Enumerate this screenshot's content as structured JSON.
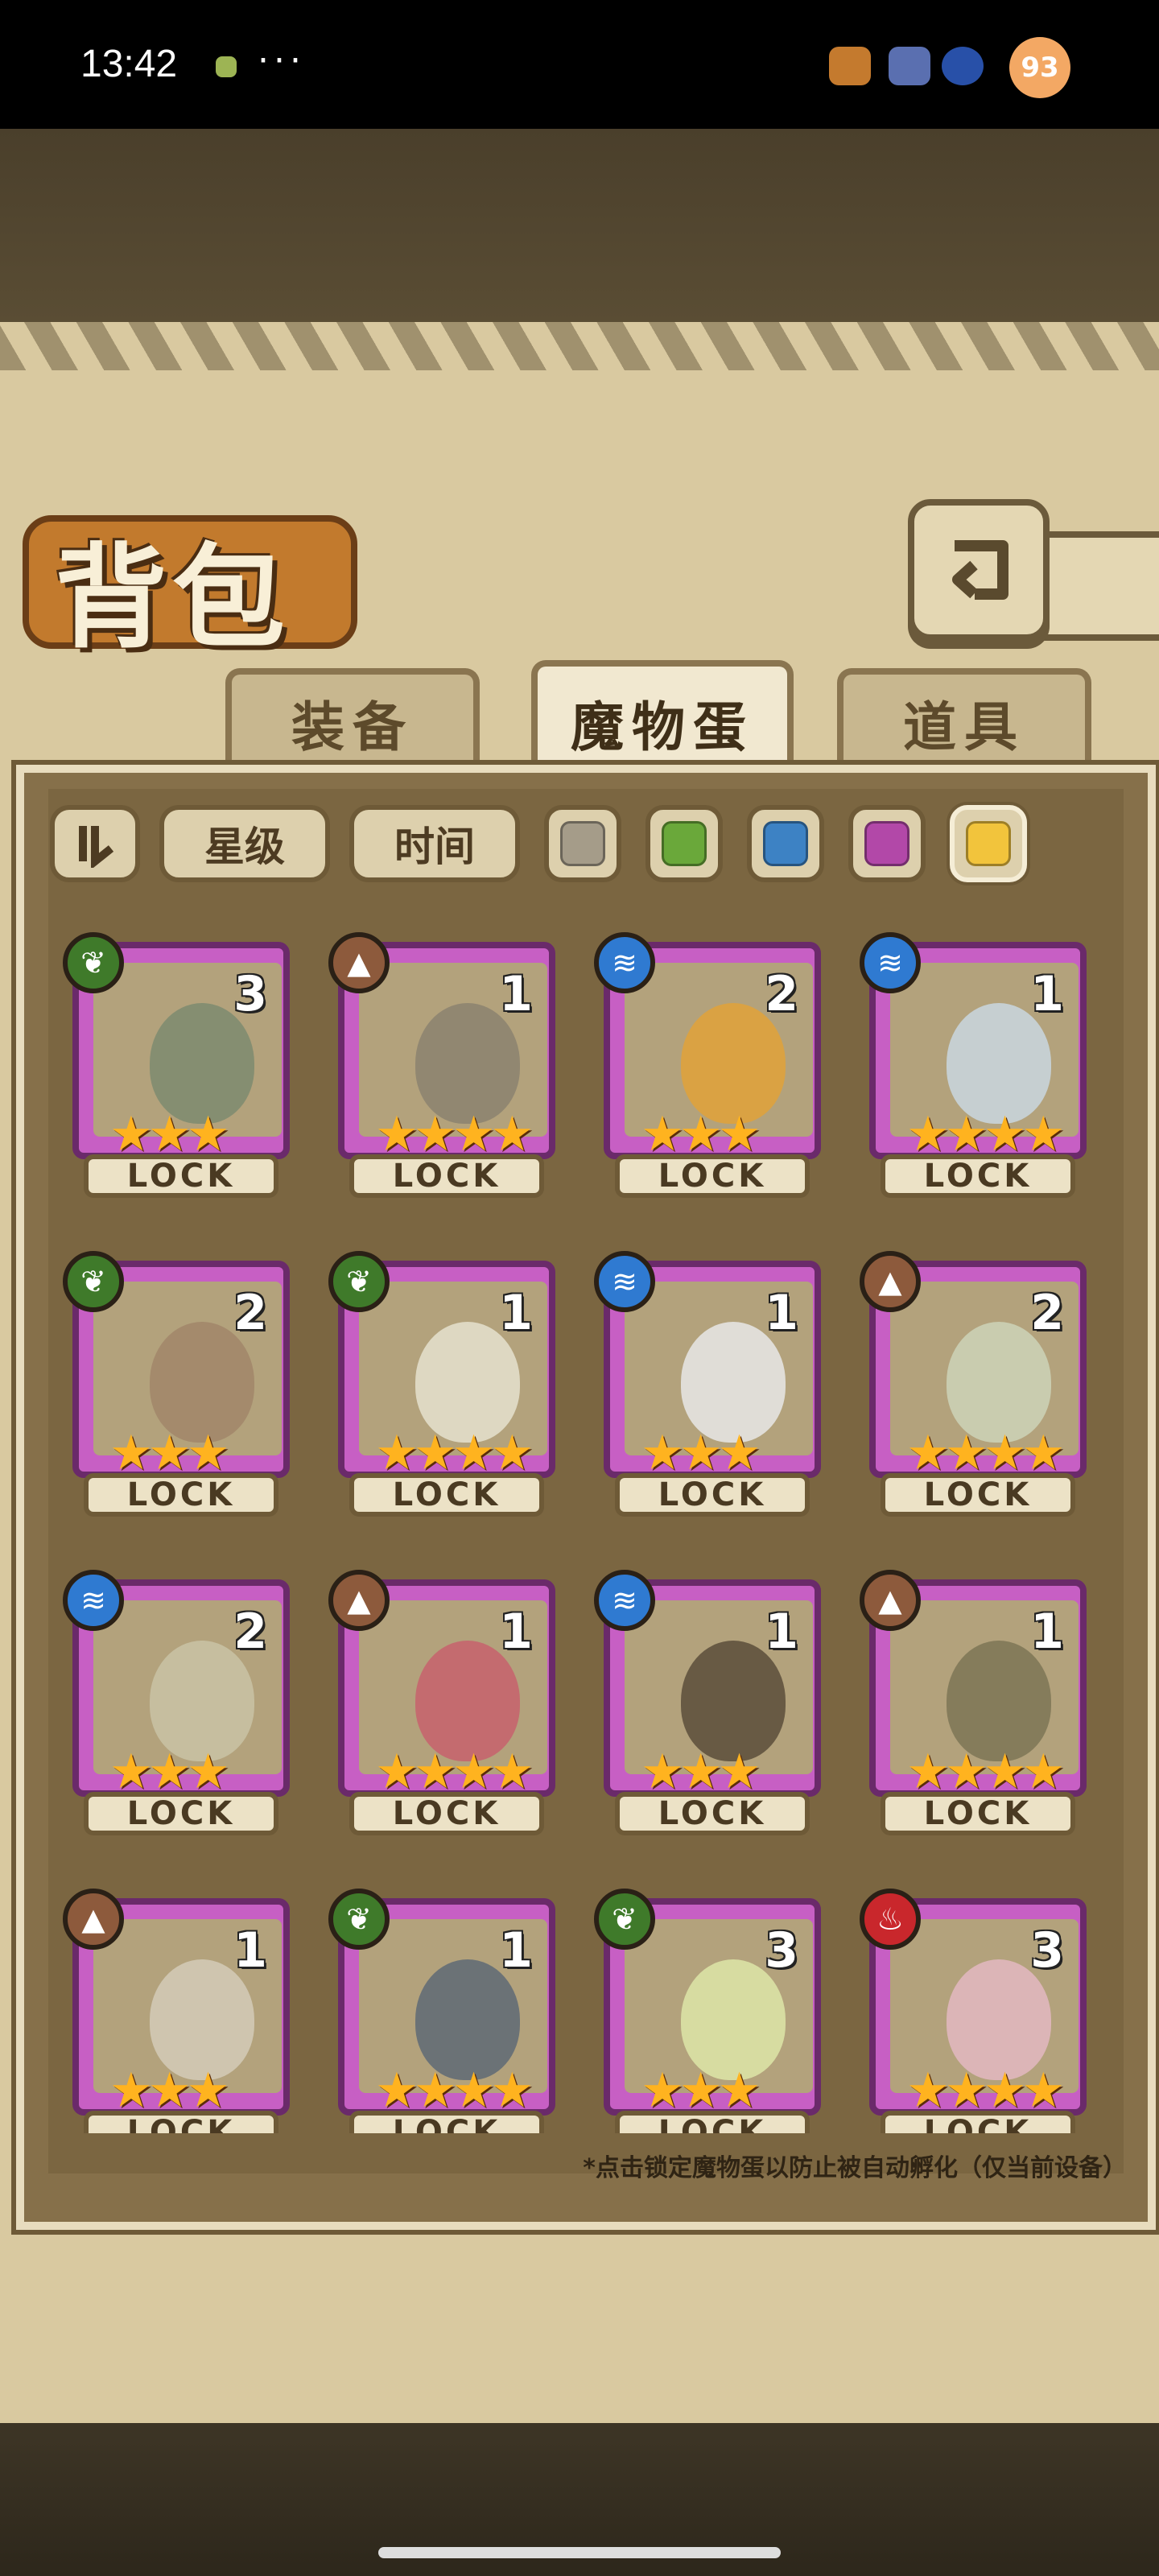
{
  "status_bar": {
    "time": "13:42",
    "more": "···",
    "badge": "93"
  },
  "title": "背包",
  "back_icon": "return-arrow-icon",
  "tabs": [
    {
      "label": "装备",
      "active": false
    },
    {
      "label": "魔物蛋",
      "active": true
    },
    {
      "label": "道具",
      "active": false
    }
  ],
  "filters": {
    "sort_icon": "sort-toggle-icon",
    "star_label": "星级",
    "time_label": "时间",
    "swatches": [
      "#a59c89",
      "#6aa83a",
      "#3d82c4",
      "#b248a8",
      "#f2c43c"
    ],
    "selected_swatch": 4
  },
  "cards": [
    {
      "element": "leaf",
      "count": "3",
      "stars": "★★★",
      "lock": "LOCK",
      "egg": "#7c8b70"
    },
    {
      "element": "earth",
      "count": "1",
      "stars": "★★★★",
      "lock": "LOCK",
      "egg": "#8b8270"
    },
    {
      "element": "water",
      "count": "2",
      "stars": "★★★",
      "lock": "LOCK",
      "egg": "#e0a23a"
    },
    {
      "element": "water",
      "count": "1",
      "stars": "★★★★",
      "lock": "LOCK",
      "egg": "#c9d7e0"
    },
    {
      "element": "leaf",
      "count": "2",
      "stars": "★★★",
      "lock": "LOCK",
      "egg": "#a1866a"
    },
    {
      "element": "leaf",
      "count": "1",
      "stars": "★★★★",
      "lock": "LOCK",
      "egg": "#e5e2cf"
    },
    {
      "element": "water",
      "count": "1",
      "stars": "★★★",
      "lock": "LOCK",
      "egg": "#e8e8e8"
    },
    {
      "element": "earth",
      "count": "2",
      "stars": "★★★★",
      "lock": "LOCK",
      "egg": "#cdd4b8"
    },
    {
      "element": "water",
      "count": "2",
      "stars": "★★★",
      "lock": "LOCK",
      "egg": "#c9c3a6"
    },
    {
      "element": "earth",
      "count": "1",
      "stars": "★★★★",
      "lock": "LOCK",
      "egg": "#c7626d"
    },
    {
      "element": "water",
      "count": "1",
      "stars": "★★★",
      "lock": "LOCK",
      "egg": "#5b4e3b"
    },
    {
      "element": "earth",
      "count": "1",
      "stars": "★★★★",
      "lock": "LOCK",
      "egg": "#7d7656"
    },
    {
      "element": "earth",
      "count": "1",
      "stars": "★★★",
      "lock": "LOCK",
      "egg": "#d4cbb8"
    },
    {
      "element": "leaf",
      "count": "1",
      "stars": "★★★★",
      "lock": "LOCK",
      "egg": "#5e6a75"
    },
    {
      "element": "leaf",
      "count": "3",
      "stars": "★★★",
      "lock": "LOCK",
      "egg": "#dde6a8"
    },
    {
      "element": "fire",
      "count": "3",
      "stars": "★★★★",
      "lock": "LOCK",
      "egg": "#e3b8c2"
    }
  ],
  "hint": "*点击锁定魔物蛋以防止被自动孵化（仅当前设备）",
  "element_colors": {
    "leaf": "#3f7a2a",
    "earth": "#8d5a3c",
    "water": "#2f7ad1",
    "fire": "#c9272c"
  },
  "element_icons": {
    "leaf": "leaf-element-icon",
    "earth": "earth-element-icon",
    "water": "water-element-icon",
    "fire": "fire-element-icon"
  }
}
